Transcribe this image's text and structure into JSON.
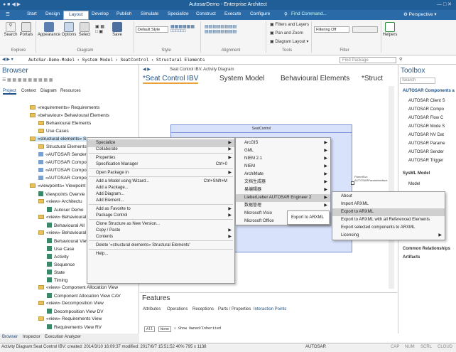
{
  "window": {
    "title": "AutosarDemo - Enterprise Architect"
  },
  "ribbon_tabs": [
    "Start",
    "Design",
    "Layout",
    "Develop",
    "Publish",
    "Simulate",
    "Specialize",
    "Construct",
    "Execute",
    "Configure"
  ],
  "ribbon_search": "Find Command...",
  "perspective": "Perspective",
  "ribbon": {
    "search": "Search",
    "portals": "Portals",
    "appearance": "Appearance",
    "options": "Options",
    "select": "Select",
    "save": "Save",
    "group_explore": "Explore",
    "group_diagram": "Diagram",
    "group_style": "Style",
    "group_alignment": "Alignment",
    "group_tools": "Tools",
    "group_filter": "Filter",
    "default_style": "Default Style",
    "filters_layers": "Filters and Layers",
    "pan_zoom": "Pan and Zoom",
    "diagram_layout": "Diagram Layout",
    "filtering_off": "Filtering Off",
    "helpers": "Helpers"
  },
  "address": {
    "path": "AutoSar-Demo-Model  ›  System Model  ›  SeatControl  ›  Structural Elements",
    "find": "Find Package"
  },
  "browser": {
    "title": "Browser",
    "tabs": [
      "Project",
      "Context",
      "Diagram",
      "Resources"
    ],
    "nodes": [
      "«requirements» Requirements",
      "«behaviour» Behavioural Elements",
      "Behavioural Elements",
      "Use Cases",
      "«structural elements» S",
      "Structural Elements",
      "«AUTOSAR Sender",
      "«AUTOSAR Compo",
      "«AUTOSAR Compo",
      "«AUTOSAR Compo",
      "«viewpoints» Viewpoint",
      "Viewpoints Overvie",
      "«view» Architectu",
      "Autoser Demo",
      "«view» Behavioural",
      "Behavioural All",
      "«view» Behavioural",
      "Behavioural View",
      "Use Case",
      "Activity",
      "Sequence",
      "State",
      "Timing",
      "«view» Component Allocation View",
      "Component Allocation View CAV",
      "«view» Decomposition View",
      "Decomposition View DV",
      "«view» Requirements View",
      "Requirements View RV"
    ],
    "bottom_tabs": [
      "Browser",
      "Inspector",
      "Execution Analyzer"
    ]
  },
  "diagram": {
    "header": "Seat Control IBV.  Activity Diagram",
    "tabs": [
      "*Seat Control IBV",
      "System Model",
      "Behavioural Elements",
      "*Struct"
    ],
    "element": "SeatControl",
    "port": "ParentSvc\nAUTOSARParamInterface"
  },
  "context_menu": [
    {
      "label": "Specialize",
      "arrow": true,
      "hl": true
    },
    {
      "label": "Collaborate",
      "arrow": true
    },
    {
      "sep": true
    },
    {
      "label": "Properties",
      "arrow": true
    },
    {
      "label": "Specification Manager",
      "shortcut": "Ctrl+0"
    },
    {
      "sep": true
    },
    {
      "label": "Open Package in",
      "arrow": true
    },
    {
      "sep": true
    },
    {
      "label": "Add a Model using Wizard...",
      "shortcut": "Ctrl+Shift+M"
    },
    {
      "label": "Add a Package..."
    },
    {
      "label": "Add Diagram..."
    },
    {
      "label": "Add Element..."
    },
    {
      "sep": true
    },
    {
      "label": "Add as Favorite to",
      "arrow": true
    },
    {
      "label": "Package Control",
      "arrow": true
    },
    {
      "sep": true
    },
    {
      "label": "Clone Structure as New Version..."
    },
    {
      "label": "Copy / Paste",
      "arrow": true
    },
    {
      "label": "Contents",
      "arrow": true
    },
    {
      "sep": true
    },
    {
      "label": "Delete '«structural elements» Structural Elements'"
    },
    {
      "sep": true
    },
    {
      "label": "Help..."
    }
  ],
  "specialize_menu": [
    "ArcGIS",
    "GML",
    "NIEM 2.1",
    "NIEM",
    "ArchiMate",
    "文档生成器",
    "易编辑器",
    "LieberLieber AUTOSAR Engineer 2",
    "数据管理",
    "Microsoft Visio",
    "Microsoft Office"
  ],
  "autosar_menu": [
    "About",
    "Import ARXML",
    "Export to ARXML",
    "Export to ARXML with all Referenced Elements",
    "Export selected components to ARXML",
    "Licensing"
  ],
  "tooltip": "Export to ARXML",
  "toolbox": {
    "title": "Toolbox",
    "search": "Search",
    "header1": "AUTOSAR Components a",
    "items": [
      "AUTOSAR Client S",
      "AUTOSAR Compo",
      "AUTOSAR Flow C",
      "AUTOSAR Mode S",
      "AUTOSAR NV Dat",
      "AUTOSAR Parame",
      "AUTOSAR Sender",
      "AUTOSAR Trigger"
    ],
    "header2": "SysML Model",
    "model": "Model",
    "bottom": [
      "Common Relationships",
      "Artifacts"
    ]
  },
  "features": {
    "title": "Features",
    "tabs": [
      "Attributes",
      "Operations",
      "Receptions",
      "Parts / Properties",
      "Interaction Points"
    ],
    "all": "All",
    "none": "None",
    "show_owned": "Show Owned/Inherited"
  },
  "status": {
    "text": "Activity Diagram:Seat Control IBV:  created: 2014/3/10 16:09:37  modified: 2017/6/7 15:51:52  40%  795 x 1138",
    "autosar": "AUTOSAR",
    "cap": "CAP",
    "num": "NUM",
    "scrl": "SCRL",
    "cloud": "CLOUD"
  }
}
